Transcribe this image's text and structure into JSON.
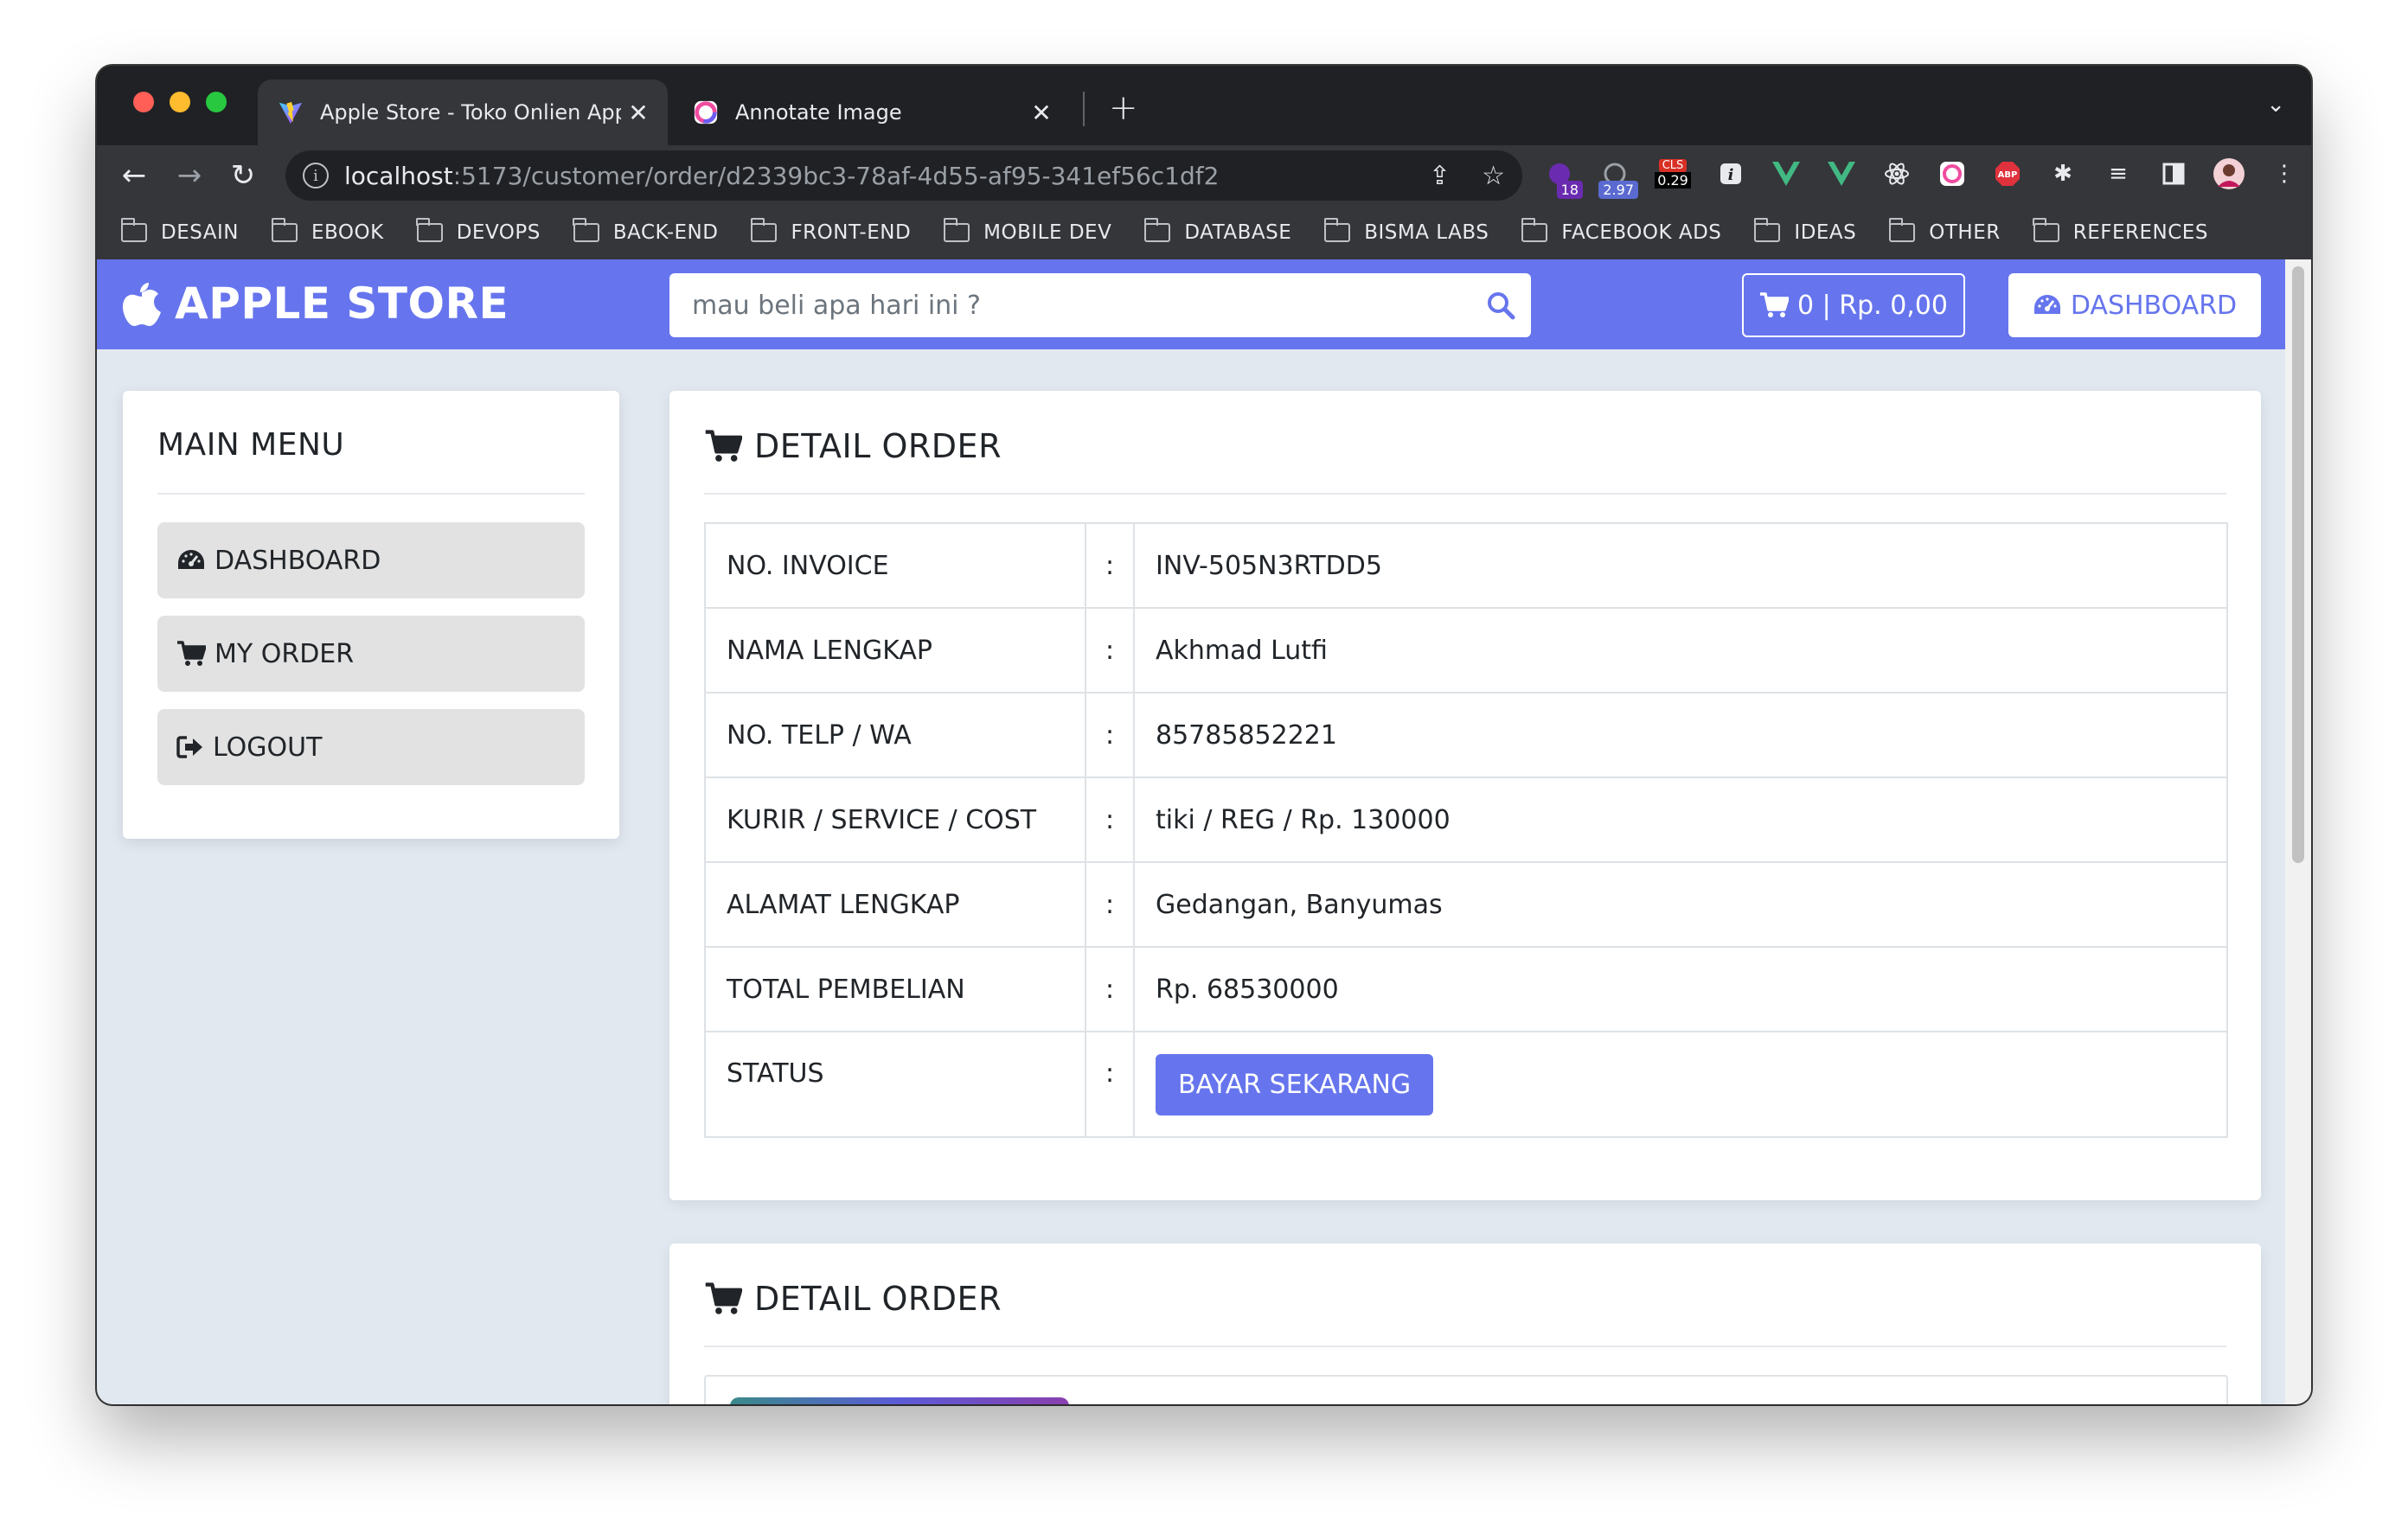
{
  "browser": {
    "tabs": [
      {
        "title": "Apple Store - Toko Onlien Apple",
        "favicon": "vite-icon",
        "active": true
      },
      {
        "title": "Annotate Image",
        "favicon": "annotate-icon",
        "active": false
      }
    ],
    "url_host": "localhost",
    "url_path": ":5173/customer/order/d2339bc3-78af-4d55-af95-341ef56c1df2",
    "extension_badges": {
      "ext1": "18",
      "ext2": "2.97",
      "cls_label": "CLS",
      "cls_value": "0.29",
      "abp": "ABP"
    },
    "bookmarks": [
      "DESAIN",
      "EBOOK",
      "DEVOPS",
      "BACK-END",
      "FRONT-END",
      "MOBILE DEV",
      "DATABASE",
      "BISMA LABS",
      "FACEBOOK ADS",
      "IDEAS",
      "OTHER",
      "REFERENCES"
    ]
  },
  "navbar": {
    "brand": "APPLE STORE",
    "search_placeholder": "mau beli apa hari ini ?",
    "cart_label": "0 | Rp. 0,00",
    "dashboard_label": "DASHBOARD"
  },
  "sidebar": {
    "title": "MAIN MENU",
    "items": [
      {
        "label": "DASHBOARD",
        "icon": "tachometer-icon"
      },
      {
        "label": "MY ORDER",
        "icon": "cart-icon"
      },
      {
        "label": "LOGOUT",
        "icon": "sign-out-icon"
      }
    ]
  },
  "order": {
    "title": "DETAIL ORDER",
    "separator": ":",
    "rows": [
      {
        "label": "NO. INVOICE",
        "value": "INV-505N3RTDD5"
      },
      {
        "label": "NAMA LENGKAP",
        "value": "Akhmad Lutfi"
      },
      {
        "label": "NO. TELP / WA",
        "value": "85785852221"
      },
      {
        "label": "KURIR / SERVICE / COST",
        "value": "tiki / REG / Rp. 130000"
      },
      {
        "label": "ALAMAT LENGKAP",
        "value": "Gedangan, Banyumas"
      },
      {
        "label": "TOTAL PEMBELIAN",
        "value": "Rp. 68530000"
      }
    ],
    "status_label": "STATUS",
    "status_button": "BAYAR SEKARANG"
  },
  "order_items": {
    "title": "DETAIL ORDER"
  },
  "colors": {
    "accent": "#6675ed",
    "page_bg": "#e2e8f0",
    "menu_item_bg": "#e2e2e2"
  }
}
